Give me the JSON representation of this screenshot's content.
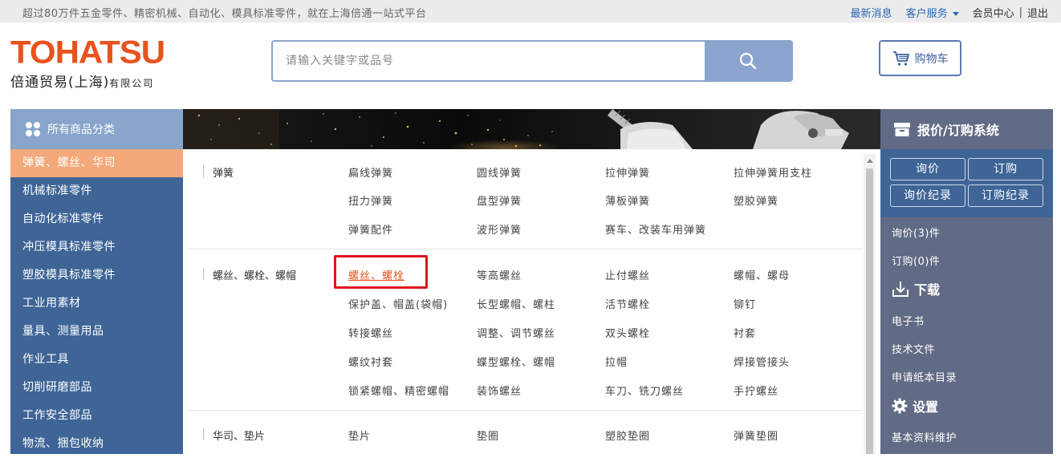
{
  "topbar": {
    "slogan": "超过80万件五金零件、精密机械、自动化、模具标准零件，就在上海倍通一站式平台",
    "latest_news": "最新消息",
    "customer_service": "客户服务",
    "member_center": "会员中心",
    "separator": "|",
    "logout": "退出"
  },
  "logo": {
    "brand": "TOHATSU",
    "company_main": "倍通贸易(上海)",
    "company_suffix": "有限公司"
  },
  "search": {
    "placeholder": "请输入关键字或品号"
  },
  "cart": {
    "label": "购物车"
  },
  "sidebar": {
    "title": "所有商品分类",
    "items": [
      {
        "label": "弹簧、螺丝、华司",
        "active": true
      },
      {
        "label": "机械标准零件"
      },
      {
        "label": "自动化标准零件"
      },
      {
        "label": "冲压模具标准零件"
      },
      {
        "label": "塑胶模具标准零件"
      },
      {
        "label": "工业用素材"
      },
      {
        "label": "量具、测量用品"
      },
      {
        "label": "作业工具"
      },
      {
        "label": "切削研磨部品"
      },
      {
        "label": "工作安全部品"
      },
      {
        "label": "物流、捆包收纳"
      }
    ]
  },
  "menu": {
    "groups": [
      {
        "title": "弹簧",
        "rows": [
          [
            "扁线弹簧",
            "圆线弹簧",
            "拉伸弹簧",
            "拉伸弹簧用支柱"
          ],
          [
            "扭力弹簧",
            "盘型弹簧",
            "薄板弹簧",
            "塑胶弹簧"
          ],
          [
            "弹簧配件",
            "波形弹簧",
            "赛车、改装车用弹簧",
            ""
          ]
        ]
      },
      {
        "title": "螺丝、螺栓、螺帽",
        "rows": [
          [
            "螺丝、螺栓",
            "等高螺丝",
            "止付螺丝",
            "螺帽、螺母"
          ],
          [
            "保护盖、帽盖(袋帽)",
            "长型螺帽、螺柱",
            "活节螺栓",
            "铆钉"
          ],
          [
            "转接螺丝",
            "调整、调节螺丝",
            "双头螺栓",
            "衬套"
          ],
          [
            "螺纹衬套",
            "蝶型螺栓、螺帽",
            "拉帽",
            "焊接管接头"
          ],
          [
            "锁紧螺帽、精密螺帽",
            "装饰螺丝",
            "车刀、铣刀螺丝",
            "手拧螺丝"
          ]
        ]
      },
      {
        "title": "华司、垫片",
        "rows": [
          [
            "垫片",
            "垫圈",
            "塑胶垫圈",
            "弹簧垫圈"
          ]
        ]
      }
    ]
  },
  "right_panel": {
    "title": "报价/订购系统",
    "buttons": {
      "inquiry": "询价",
      "order": "订购",
      "inquiry_records": "询价纪录",
      "order_records": "订购纪录"
    },
    "inquiry_count": "询价(3)件",
    "order_count": "订购(0)件",
    "download_title": "下载",
    "ebook": "电子书",
    "tech_docs": "技术文件",
    "paper_catalog": "申请纸本目录",
    "settings_title": "设置",
    "profile": "基本资料维护"
  },
  "colors": {
    "brand_orange": "#e8521d",
    "nav_blue": "#3f6597",
    "light_blue": "#89a5cc",
    "active_orange": "#f4a97a",
    "right_gray": "#626b85",
    "highlight_red": "#e0141a"
  }
}
